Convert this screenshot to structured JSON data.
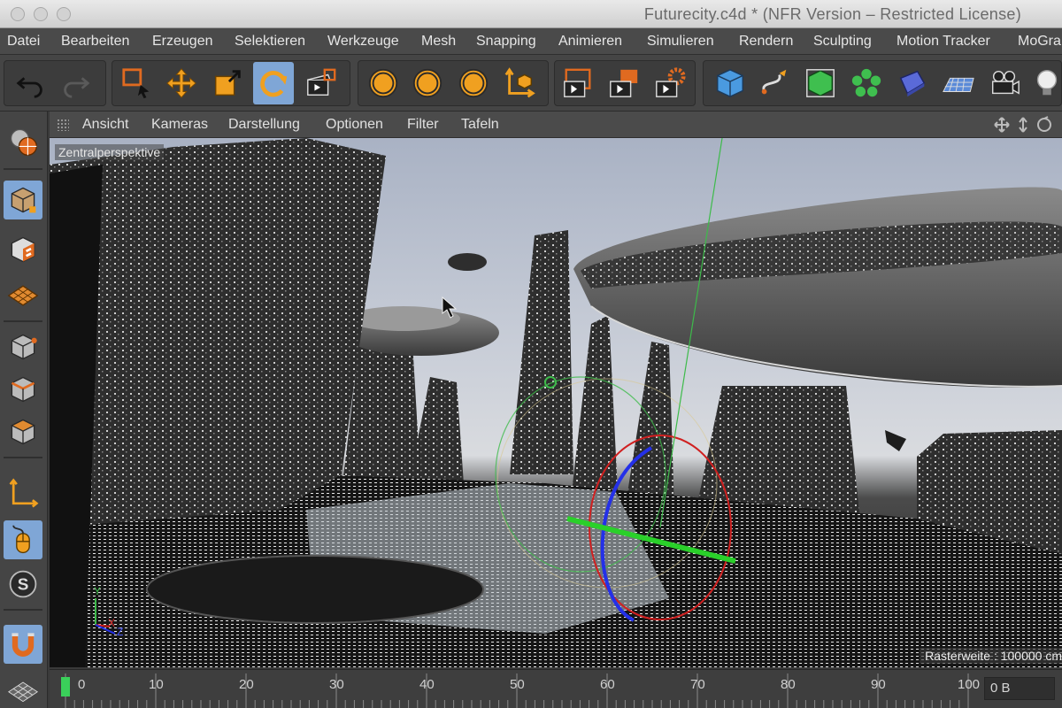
{
  "window": {
    "title": "Futurecity.c4d * (NFR Version – Restricted License)"
  },
  "menubar": {
    "items": [
      "Datei",
      "Bearbeiten",
      "Erzeugen",
      "Selektieren",
      "Werkzeuge",
      "Mesh",
      "Snapping",
      "Animieren",
      "Simulieren",
      "Rendern",
      "Sculpting",
      "Motion Tracker",
      "MoGra"
    ]
  },
  "toolbar": {
    "axis_x": "X",
    "axis_y": "Y",
    "axis_z": "Z",
    "accent": "#7fa6d6",
    "icons": [
      "undo-icon",
      "redo-icon",
      "live-selection-icon",
      "move-icon",
      "scale-icon",
      "rotate-icon",
      "recent-tools-icon",
      "x-axis-lock-icon",
      "y-axis-lock-icon",
      "z-axis-lock-icon",
      "coordinate-system-icon",
      "render-view-icon",
      "render-to-picture-viewer-icon",
      "render-settings-icon",
      "cube-icon",
      "spline-pen-icon",
      "subdivision-icon",
      "cloner-icon",
      "deformer-icon",
      "floor-icon",
      "camera-icon",
      "light-icon"
    ]
  },
  "viewport": {
    "menu": [
      "Ansicht",
      "Kameras",
      "Darstellung",
      "Optionen",
      "Filter",
      "Tafeln"
    ],
    "camera_label": "Zentralperspektive",
    "grid_label": "Rasterweite : 100000 cm",
    "axis_labels": {
      "x": "X",
      "y": "Y",
      "z": "Z"
    }
  },
  "timeline": {
    "ticks": [
      "0",
      "10",
      "20",
      "30",
      "40",
      "50",
      "60",
      "70",
      "80",
      "90",
      "100"
    ],
    "frame_value": "0 B"
  }
}
